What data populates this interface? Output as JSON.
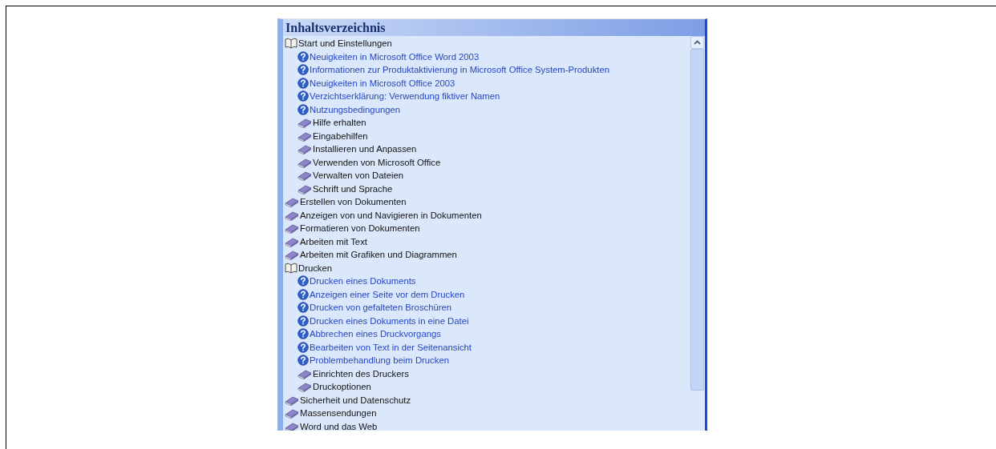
{
  "panel": {
    "title": "Inhaltsverzeichnis"
  },
  "tree": [
    {
      "kind": "book",
      "label": "Start und Einstellungen",
      "expanded": true,
      "children": [
        {
          "kind": "topic",
          "label": "Neuigkeiten in Microsoft Office Word 2003"
        },
        {
          "kind": "topic",
          "label": "Informationen zur Produktaktivierung in Microsoft Office System-Produkten"
        },
        {
          "kind": "topic",
          "label": "Neuigkeiten in Microsoft Office 2003"
        },
        {
          "kind": "topic",
          "label": "Verzichtserklärung: Verwendung fiktiver Namen"
        },
        {
          "kind": "topic",
          "label": "Nutzungsbedingungen"
        },
        {
          "kind": "book",
          "label": "Hilfe erhalten",
          "expanded": false
        },
        {
          "kind": "book",
          "label": "Eingabehilfen",
          "expanded": false
        },
        {
          "kind": "book",
          "label": "Installieren und Anpassen",
          "expanded": false
        },
        {
          "kind": "book",
          "label": "Verwenden von Microsoft Office",
          "expanded": false
        },
        {
          "kind": "book",
          "label": "Verwalten von Dateien",
          "expanded": false
        },
        {
          "kind": "book",
          "label": "Schrift und Sprache",
          "expanded": false
        }
      ]
    },
    {
      "kind": "book",
      "label": "Erstellen von Dokumenten",
      "expanded": false
    },
    {
      "kind": "book",
      "label": "Anzeigen von und Navigieren in Dokumenten",
      "expanded": false
    },
    {
      "kind": "book",
      "label": "Formatieren von Dokumenten",
      "expanded": false
    },
    {
      "kind": "book",
      "label": "Arbeiten mit Text",
      "expanded": false
    },
    {
      "kind": "book",
      "label": "Arbeiten mit Grafiken und Diagrammen",
      "expanded": false
    },
    {
      "kind": "book",
      "label": "Drucken",
      "expanded": true,
      "children": [
        {
          "kind": "topic",
          "label": "Drucken eines Dokuments"
        },
        {
          "kind": "topic",
          "label": "Anzeigen einer Seite vor dem Drucken"
        },
        {
          "kind": "topic",
          "label": "Drucken von gefalteten Broschüren"
        },
        {
          "kind": "topic",
          "label": "Drucken eines Dokuments in eine Datei"
        },
        {
          "kind": "topic",
          "label": "Abbrechen eines Druckvorgangs"
        },
        {
          "kind": "topic",
          "label": "Bearbeiten von Text in der Seitenansicht"
        },
        {
          "kind": "topic",
          "label": "Problembehandlung beim Drucken"
        },
        {
          "kind": "book",
          "label": "Einrichten des Druckers",
          "expanded": false
        },
        {
          "kind": "book",
          "label": "Druckoptionen",
          "expanded": false
        }
      ]
    },
    {
      "kind": "book",
      "label": "Sicherheit und Datenschutz",
      "expanded": false
    },
    {
      "kind": "book",
      "label": "Massensendungen",
      "expanded": false
    },
    {
      "kind": "book",
      "label": "Word und das Web",
      "expanded": false
    }
  ]
}
